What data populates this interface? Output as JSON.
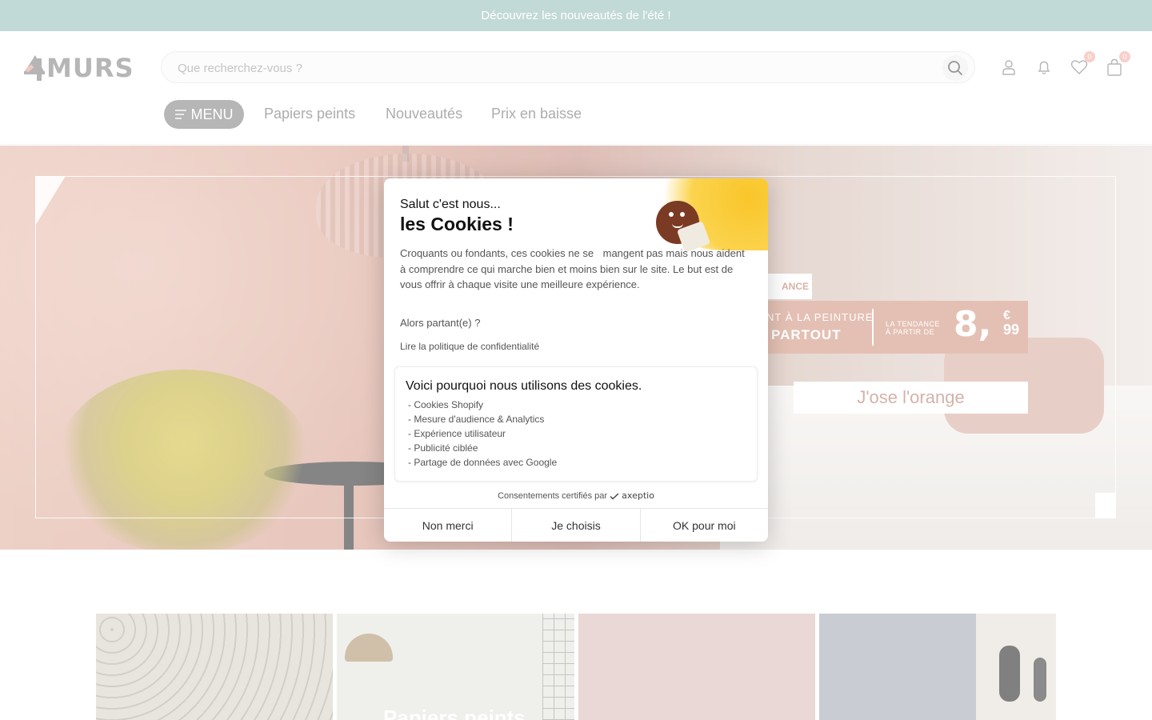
{
  "announcement": {
    "text": "Découvrez les nouveautés de l'été !"
  },
  "header": {
    "logo_text": "MURS",
    "search": {
      "placeholder": "Que recherchez-vous ?"
    },
    "wishlist_count": "0",
    "cart_count": "0",
    "nav": {
      "menu_label": "MENU",
      "links": [
        "Papiers peints",
        "Nouveautés",
        "Prix en baisse"
      ]
    }
  },
  "hero": {
    "tag_partial": "ANCE",
    "band_line1": "NT À LA PEINTURE",
    "band_line2": "PARTOUT",
    "band_small_line1": "LA TENDANCE",
    "band_small_line2": "À PARTIR DE",
    "price_int": "8,",
    "price_currency": "€",
    "price_dec": "99",
    "cta": "J'ose l'orange"
  },
  "categories": {
    "tile2_title": "Papiers peints"
  },
  "cookie_modal": {
    "greeting": "Salut c'est nous...",
    "title": "les Cookies !",
    "description_first": "Croquants ou fondants, ces cookies ne se",
    "description_rest": "mangent pas mais nous aident à comprendre ce qui marche bien et moins bien sur le site. Le but est de vous offrir à chaque visite une meilleure expérience.",
    "question": "Alors partant(e) ?",
    "privacy_link": "Lire la politique de confidentialité",
    "why_title": "Voici pourquoi nous utilisons des cookies.",
    "purposes": [
      "- Cookies Shopify",
      "- Mesure d'audience & Analytics",
      "- Expérience utilisateur",
      "- Publicité ciblée",
      "- Partage de données avec Google"
    ],
    "certified_text": "Consentements certifiés par",
    "certified_brand": "axeptio",
    "buttons": {
      "refuse": "Non merci",
      "choose": "Je choisis",
      "accept": "OK pour moi"
    }
  },
  "colors": {
    "announcement_bg": "#9dc3be",
    "menu_button_bg": "#8a8a8a",
    "badge": "#f4b3a8",
    "promo_band": "#d49a86"
  },
  "icons": [
    "search-icon",
    "user-icon",
    "bell-icon",
    "heart-icon",
    "bag-icon",
    "hamburger-icon",
    "cookie-mascot-icon",
    "axeptio-check-icon"
  ]
}
